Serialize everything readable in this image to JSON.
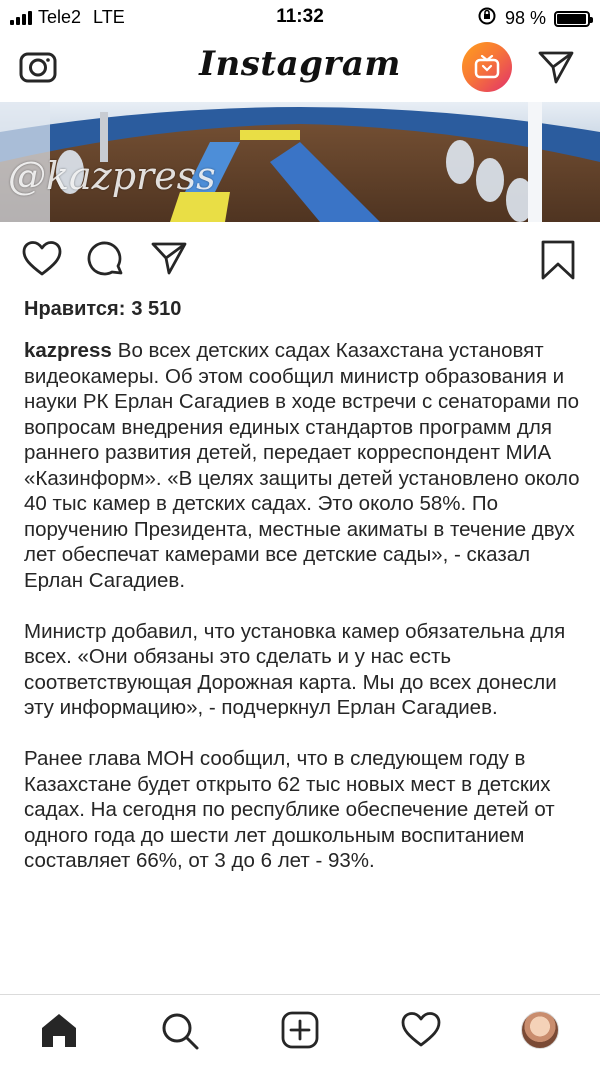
{
  "status": {
    "carrier": "Tele2",
    "network": "LTE",
    "time": "11:32",
    "battery": "98 %",
    "battery_level": 0.98
  },
  "header": {
    "logo": "Instagram",
    "camera_icon": "camera-icon",
    "igtv_icon": "igtv-icon",
    "direct_icon": "paper-plane-icon"
  },
  "post": {
    "watermark": "@kazpress",
    "likes_label": "Нравится:",
    "likes_count": "3 510",
    "username": "kazpress",
    "paragraph1": "Во всех детских садах Казахстана установят видеокамеры. Об этом сообщил министр образования и науки РК Ерлан Сагадиев в ходе встречи с сенаторами по вопросам внедрения единых стандартов программ для раннего развития детей, передает корреспондент МИА «Казинформ». «В целях защиты детей установлено около 40 тыс камер в детских садах. Это около 58%. По поручению Президента, местные акиматы в течение двух лет обеспечат камерами все детские сады», - сказал Ерлан Сагадиев.",
    "paragraph2": "Министр добавил, что установка камер обязательна для всех. «Они обязаны это сделать и у нас есть соответствующая Дорожная карта. Мы до всех донесли эту информацию», - подчеркнул Ерлан Сагадиев.",
    "paragraph3": "Ранее глава МОН сообщил, что в следующем году в Казахстане будет открыто 62 тыс новых мест в детских садах. На сегодня по республике обеспечение детей от одного года до шести лет дошкольным воспитанием составляет 66%, от 3 до 6 лет - 93%."
  },
  "actions": [
    "heart-icon",
    "comment-icon",
    "share-icon",
    "bookmark-icon"
  ],
  "tabbar": [
    "home-icon",
    "search-icon",
    "add-post-icon",
    "activity-heart-icon",
    "profile-avatar"
  ],
  "colors": {
    "text": "#262626",
    "igtv_gradient_start": "#ff9f1c",
    "igtv_gradient_end": "#e1306c",
    "divider": "#dbdbdb"
  }
}
